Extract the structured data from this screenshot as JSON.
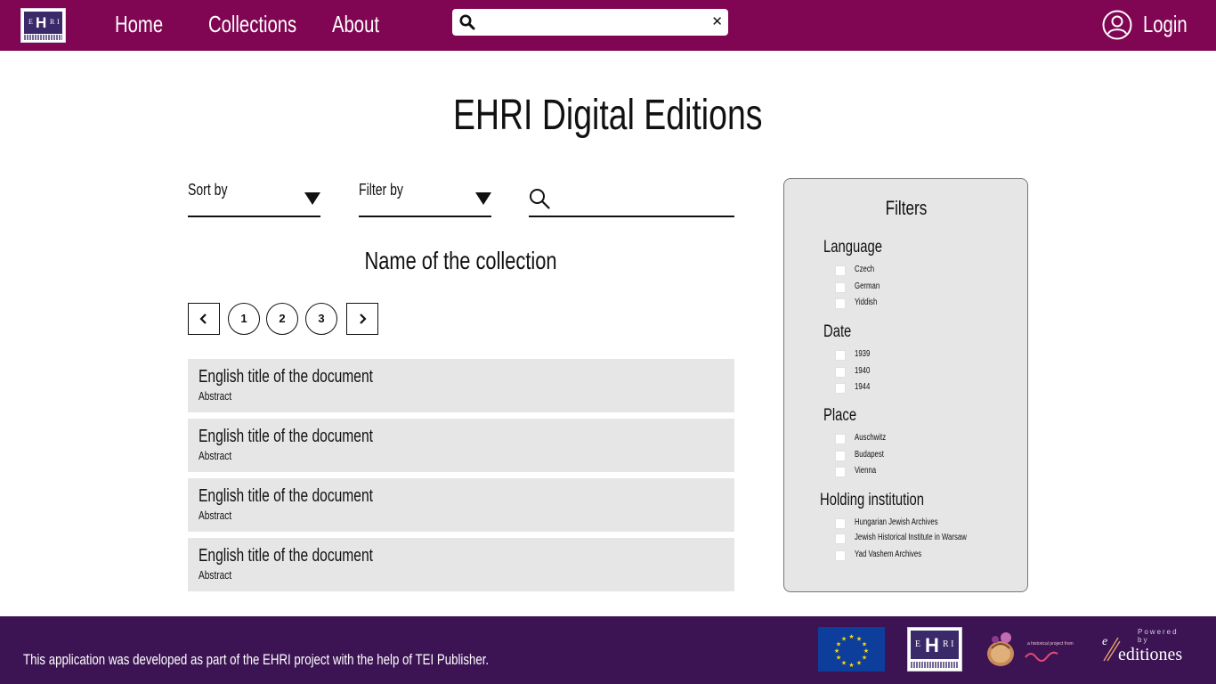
{
  "nav": {
    "home": "Home",
    "collections": "Collections",
    "about": "About",
    "search_placeholder": "",
    "login": "Login"
  },
  "page": {
    "title": "EHRI Digital Editions",
    "sort_label": "Sort by",
    "filter_label": "Filter by",
    "collection_name": "Name of the collection"
  },
  "pagination": {
    "pages": [
      "1",
      "2",
      "3"
    ]
  },
  "documents": [
    {
      "title": "English title of the document",
      "abstract": "Abstract"
    },
    {
      "title": "English title of the document",
      "abstract": "Abstract"
    },
    {
      "title": "English title of the document",
      "abstract": "Abstract"
    },
    {
      "title": "English title of the document",
      "abstract": "Abstract"
    }
  ],
  "filters": {
    "title": "Filters",
    "groups": [
      {
        "title": "Language",
        "options": [
          "Czech",
          "German",
          "Yiddish"
        ]
      },
      {
        "title": "Date",
        "options": [
          "1939",
          "1940",
          "1944"
        ]
      },
      {
        "title": "Place",
        "options": [
          "Auschwitz",
          "Budapest",
          "Vienna"
        ]
      },
      {
        "title": "Holding institution",
        "options": [
          "Hungarian Jewish Archives",
          "Jewish Historical Institute in Warsaw",
          "Yad Vashem Archives"
        ]
      }
    ]
  },
  "footer": {
    "text": "This application was developed as part of the EHRI project with the help of TEI Publisher.",
    "powered_by": "Powered by",
    "editiones": "editiones",
    "partner_text": "a historical project from"
  },
  "colors": {
    "nav_bg": "#800552",
    "footer_bg": "#3c1453",
    "panel_bg": "#e6e6e6",
    "eu_blue": "#0e3e9c",
    "eu_stars": "#ffdd00"
  },
  "icons": {
    "nav_search": "search-icon",
    "clear": "close-icon",
    "user": "user-circle-icon",
    "list_search": "search-icon",
    "prev": "chevron-left-icon",
    "next": "chevron-right-icon"
  }
}
